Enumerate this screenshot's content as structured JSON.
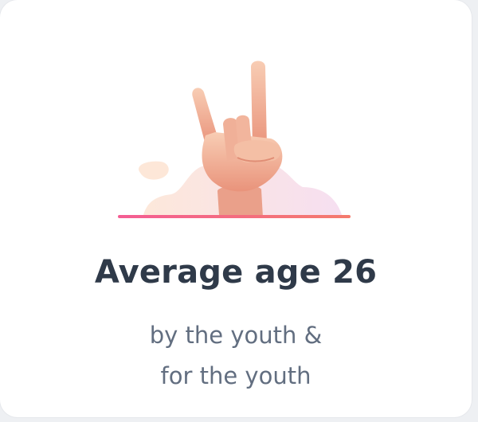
{
  "card": {
    "title": "Average age 26",
    "subtitle_lines": [
      "by the youth &",
      "for the youth"
    ]
  },
  "illustration": {
    "icon": "rock-hand-icon",
    "colors": {
      "skin_light": "#f7c7ad",
      "skin_dark": "#e58f78",
      "underline_start": "#f45d93",
      "underline_end": "#f47b6d",
      "blob_peach": "#fde5d7",
      "blob_pink": "#f7dff0"
    }
  }
}
